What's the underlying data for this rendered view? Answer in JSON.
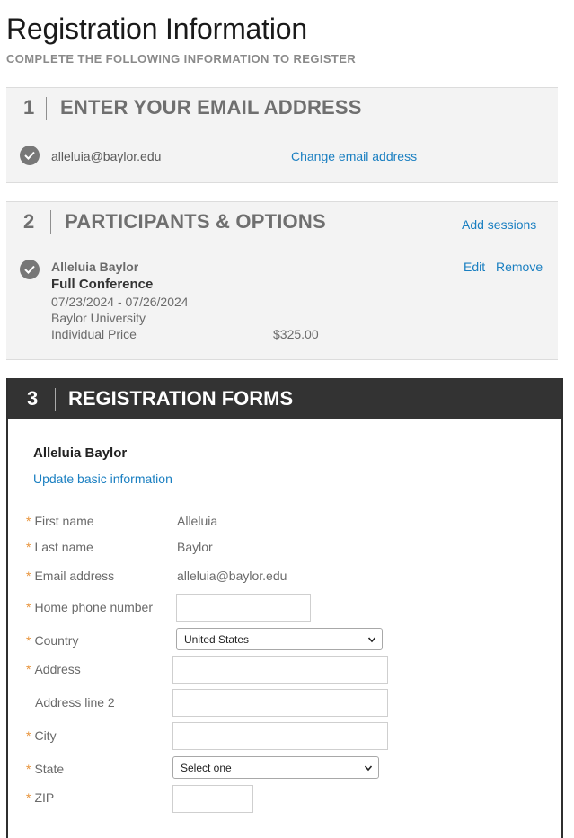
{
  "page": {
    "title": "Registration Information",
    "subtitle": "COMPLETE THE FOLLOWING INFORMATION TO REGISTER"
  },
  "step1": {
    "number": "1",
    "title": "ENTER YOUR EMAIL ADDRESS",
    "email": "alleluia@baylor.edu",
    "change_link": "Change email address"
  },
  "step2": {
    "number": "2",
    "title": "PARTICIPANTS & OPTIONS",
    "add_sessions": "Add sessions",
    "participant": {
      "name": "Alleluia Baylor",
      "option": "Full Conference",
      "dates": "07/23/2024 - 07/26/2024",
      "organization": "Baylor University",
      "price_label": "Individual Price",
      "price": "$325.00",
      "edit": "Edit",
      "remove": "Remove"
    }
  },
  "step3": {
    "number": "3",
    "title": "REGISTRATION FORMS",
    "participant_name": "Alleluia Baylor",
    "update_link": "Update basic information",
    "fields": {
      "first_name": {
        "label": "First name",
        "value": "Alleluia"
      },
      "last_name": {
        "label": "Last name",
        "value": "Baylor"
      },
      "email": {
        "label": "Email address",
        "value": "alleluia@baylor.edu"
      },
      "home_phone": {
        "label": "Home phone number",
        "value": ""
      },
      "country": {
        "label": "Country",
        "value": "United States"
      },
      "address": {
        "label": "Address",
        "value": ""
      },
      "address2": {
        "label": "Address line 2",
        "value": ""
      },
      "city": {
        "label": "City",
        "value": ""
      },
      "state": {
        "label": "State",
        "value": "Select one"
      },
      "zip": {
        "label": "ZIP",
        "value": ""
      }
    },
    "required_marker": "*"
  },
  "colors": {
    "link": "#1a7fc1",
    "required": "#e8933a",
    "header_dark": "#333333"
  }
}
